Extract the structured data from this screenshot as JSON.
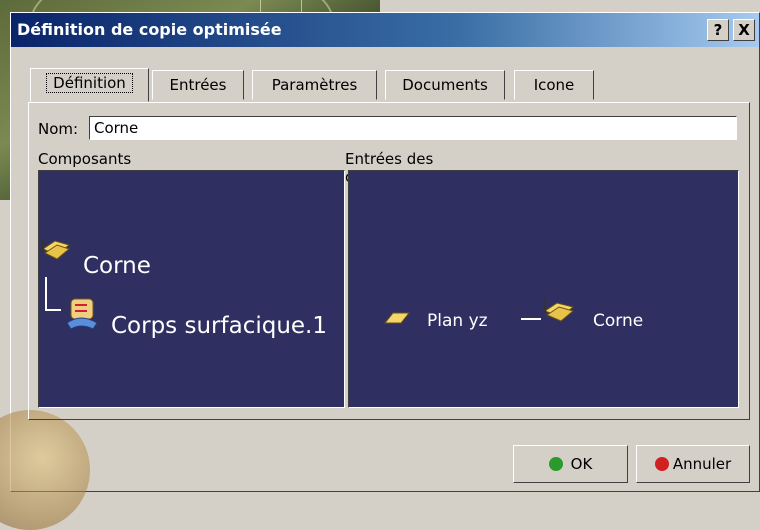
{
  "window": {
    "title": "Définition de copie optimisée",
    "help_label": "?",
    "close_label": "X"
  },
  "tabs": [
    {
      "label": "Définition",
      "active": true
    },
    {
      "label": "Entrées",
      "active": false
    },
    {
      "label": "Paramètres",
      "active": false
    },
    {
      "label": "Documents",
      "active": false
    },
    {
      "label": "Icone",
      "active": false
    }
  ],
  "form": {
    "nom_label": "Nom:",
    "nom_value": "Corne"
  },
  "composants": {
    "label": "Composants",
    "root": "Corne",
    "child": "Corps surfacique.1"
  },
  "entrees": {
    "label": "Entrées des composants",
    "input": "Plan yz",
    "target": "Corne"
  },
  "buttons": {
    "ok": "OK",
    "cancel": "Annuler"
  },
  "colors": {
    "panel_bg": "#302f61",
    "ok_dot": "#2a9a2a",
    "cancel_dot": "#d02020"
  }
}
